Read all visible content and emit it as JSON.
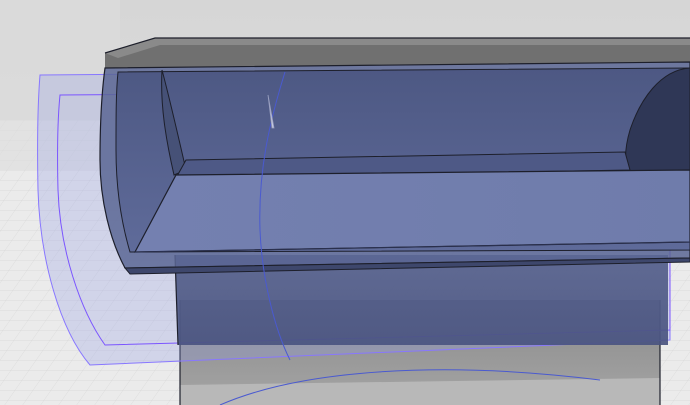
{
  "viewport": {
    "background_color": "#eaeaea",
    "grid_color": "#c9c9c9",
    "model_color": "#6b7bb0",
    "edge_color": "#1d1f2b",
    "highlight_color": "#7b55ff",
    "axis_color": "#4a5ad0"
  }
}
